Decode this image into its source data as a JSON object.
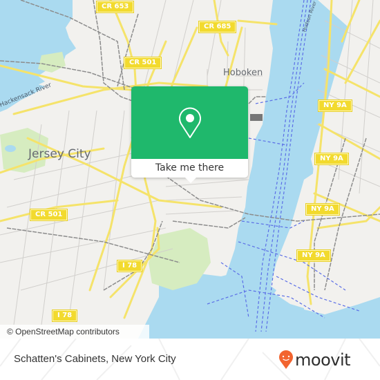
{
  "map": {
    "colors": {
      "land": "#f2f1ee",
      "water": "#aadaf0",
      "park": "#d6ecc0",
      "major_road": "#f5e36a",
      "minor_road": "#c9c7c4",
      "rail": "#8c8c8c",
      "ferry": "#5b6ee6"
    },
    "city_labels": [
      {
        "name": "jersey-city",
        "text": "Jersey City"
      },
      {
        "name": "hoboken",
        "text": "Hoboken"
      }
    ],
    "river_labels": [
      {
        "name": "hackensack-river",
        "text": "Hackensack River"
      },
      {
        "name": "hudson-river",
        "text": "Hudson River"
      }
    ],
    "road_labels": [
      {
        "name": "cr-653",
        "text": "CR 653"
      },
      {
        "name": "cr-685",
        "text": "CR 685"
      },
      {
        "name": "cr-501-north",
        "text": "CR 501"
      },
      {
        "name": "cr-501-west",
        "text": "CR 501"
      },
      {
        "name": "ny-9a-1",
        "text": "NY 9A"
      },
      {
        "name": "ny-9a-2",
        "text": "NY 9A"
      },
      {
        "name": "ny-9a-3",
        "text": "NY 9A"
      },
      {
        "name": "ny-9a-4",
        "text": "NY 9A"
      },
      {
        "name": "i-78-east",
        "text": "I 78"
      },
      {
        "name": "i-78-west",
        "text": "I 78"
      }
    ],
    "attribution": "© OpenStreetMap contributors"
  },
  "popup": {
    "button_label": "Take me there",
    "icon": "map-pin-icon",
    "color": "#1fb86c"
  },
  "footer": {
    "place_name": "Schatten's Cabinets, New York City",
    "brand": "moovit",
    "brand_color": "#f2642f"
  }
}
